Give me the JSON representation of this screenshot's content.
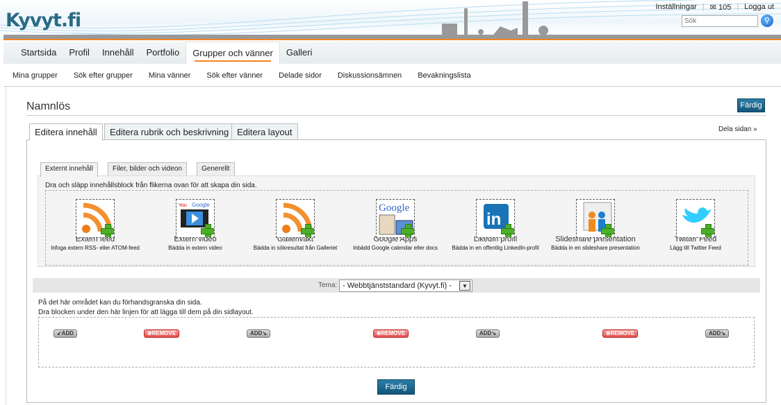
{
  "header": {
    "logo": "Kyvyt.fi",
    "settings": "Inställningar",
    "messages_count": "105",
    "logout": "Logga ut",
    "search_placeholder": "Sök"
  },
  "nav": {
    "tabs": [
      "Startsida",
      "Profil",
      "Innehåll",
      "Portfolio",
      "Grupper och vänner",
      "Galleri"
    ],
    "active": "Grupper och vänner"
  },
  "subnav": [
    "Mina grupper",
    "Sök efter grupper",
    "Mina vänner",
    "Sök efter vänner",
    "Delade sidor",
    "Diskussionsämnen",
    "Bevakningslista"
  ],
  "page": {
    "title": "Namnlös",
    "done": "Färdig",
    "share": "Dela sidan »",
    "tabs": [
      "Editera innehåll",
      "Editera rubrik och beskrivning",
      "Editera layout"
    ],
    "inner_tabs": [
      "Externt innehåll",
      "Filer, bilder och videon",
      "Generellt"
    ],
    "drag_hint": "Dra och släpp innehållsblock från flikerna ovan för att skapa din sida.",
    "blocks": [
      {
        "title": "Extern feed",
        "desc": "Infoga extern RSS- eller ATOM-feed",
        "icon": "rss-icon"
      },
      {
        "title": "Extern video",
        "desc": "Bädda in extern video",
        "icon": "video-icon"
      },
      {
        "title": "Gallerivakt",
        "desc": "Bädda in sökresultat från Galleriet",
        "icon": "rss-icon"
      },
      {
        "title": "Google Apps",
        "desc": "Inbädd Google calendar eller docs",
        "icon": "google-icon"
      },
      {
        "title": "LikedIn profil",
        "desc": "Bädda in en offentlig LinkedIn-profil",
        "icon": "linkedin-icon"
      },
      {
        "title": "Slideshare presentation",
        "desc": "Bädda in en slideshare presentation",
        "icon": "slideshare-icon"
      },
      {
        "title": "Twitter Feed",
        "desc": "Lägg till Twitter Feed",
        "icon": "twitter-icon"
      }
    ],
    "theme_label": "Tema:",
    "theme_value": "- Webbtjänststandard (Kyvyt.fi) -",
    "preview_line1": "På det här området kan du förhandsgranska din sida.",
    "preview_line2": "Dra blocken under den här linjen för att lägga till dem på din sidlayout.",
    "layout_buttons": [
      "ADD",
      "REMOVE",
      "ADD",
      "REMOVE",
      "ADD",
      "REMOVE",
      "ADD"
    ]
  },
  "colors": {
    "accent": "#f58220",
    "button": "#1d6a90"
  }
}
